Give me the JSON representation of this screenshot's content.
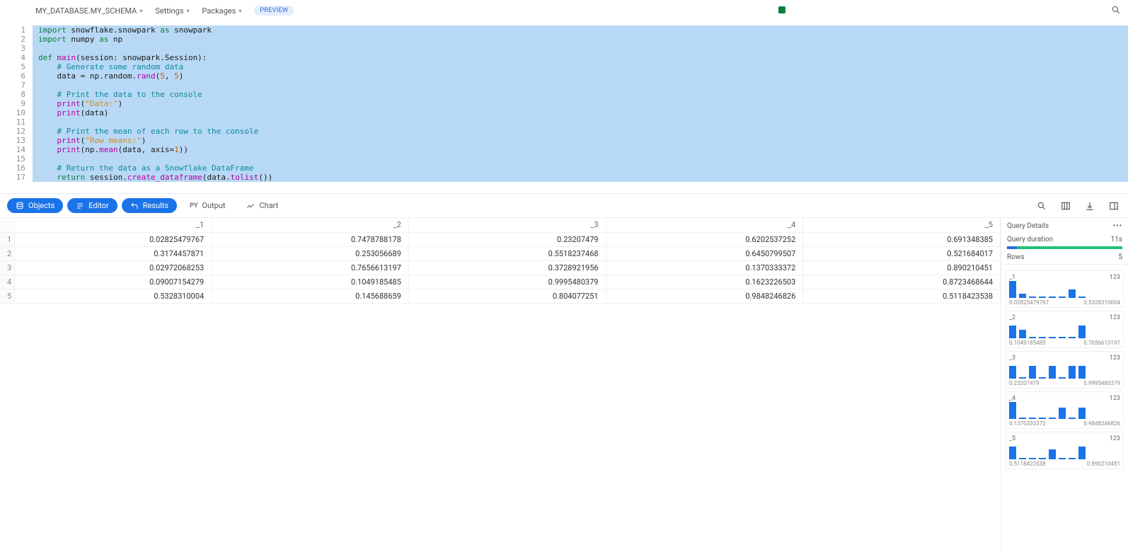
{
  "toolbar": {
    "context": "MY_DATABASE.MY_SCHEMA",
    "settings": "Settings",
    "packages": "Packages",
    "preview": "PREVIEW"
  },
  "editor": {
    "lines": [
      [
        [
          "kw",
          "import"
        ],
        [
          "id",
          " snowflake.snowpark "
        ],
        [
          "kw",
          "as"
        ],
        [
          "id",
          " snowpark"
        ]
      ],
      [
        [
          "kw",
          "import"
        ],
        [
          "id",
          " numpy "
        ],
        [
          "kw",
          "as"
        ],
        [
          "id",
          " np"
        ]
      ],
      [
        [
          "id",
          ""
        ]
      ],
      [
        [
          "kw",
          "def "
        ],
        [
          "fn",
          "main"
        ],
        [
          "id",
          "(session: snowpark.Session):"
        ]
      ],
      [
        [
          "id",
          "    "
        ],
        [
          "cm",
          "# Generate some random data"
        ]
      ],
      [
        [
          "id",
          "    data = np.random."
        ],
        [
          "fn",
          "rand"
        ],
        [
          "id",
          "("
        ],
        [
          "num",
          "5"
        ],
        [
          "id",
          ", "
        ],
        [
          "num",
          "5"
        ],
        [
          "id",
          ")"
        ]
      ],
      [
        [
          "id",
          ""
        ]
      ],
      [
        [
          "id",
          "    "
        ],
        [
          "cm",
          "# Print the data to the console"
        ]
      ],
      [
        [
          "id",
          "    "
        ],
        [
          "fn",
          "print"
        ],
        [
          "id",
          "("
        ],
        [
          "str",
          "\"Data:\""
        ],
        [
          "id",
          ")"
        ]
      ],
      [
        [
          "id",
          "    "
        ],
        [
          "fn",
          "print"
        ],
        [
          "id",
          "(data)"
        ]
      ],
      [
        [
          "id",
          ""
        ]
      ],
      [
        [
          "id",
          "    "
        ],
        [
          "cm",
          "# Print the mean of each row to the console"
        ]
      ],
      [
        [
          "id",
          "    "
        ],
        [
          "fn",
          "print"
        ],
        [
          "id",
          "("
        ],
        [
          "str",
          "\"Row means:\""
        ],
        [
          "id",
          ")"
        ]
      ],
      [
        [
          "id",
          "    "
        ],
        [
          "fn",
          "print"
        ],
        [
          "id",
          "(np."
        ],
        [
          "fn",
          "mean"
        ],
        [
          "id",
          "(data, axis="
        ],
        [
          "num",
          "1"
        ],
        [
          "id",
          "))"
        ]
      ],
      [
        [
          "id",
          ""
        ]
      ],
      [
        [
          "id",
          "    "
        ],
        [
          "cm",
          "# Return the data as a Snowflake DataFrame"
        ]
      ],
      [
        [
          "id",
          "    "
        ],
        [
          "kw",
          "return"
        ],
        [
          "id",
          " session."
        ],
        [
          "fn",
          "create_dataframe"
        ],
        [
          "id",
          "(data."
        ],
        [
          "fn",
          "tolist"
        ],
        [
          "id",
          "())"
        ]
      ]
    ]
  },
  "result_tabs": {
    "objects": "Objects",
    "editor": "Editor",
    "results": "Results",
    "output": "Output",
    "output_prefix": "PY",
    "chart": "Chart"
  },
  "table": {
    "headers": [
      "_1",
      "_2",
      "_3",
      "_4",
      "_5"
    ],
    "rows": [
      [
        "0.02825479767",
        "0.7478788178",
        "0.23207479",
        "0.6202537252",
        "0.691348385"
      ],
      [
        "0.3174457871",
        "0.253056689",
        "0.5518237468",
        "0.6450799507",
        "0.521684017"
      ],
      [
        "0.02972068253",
        "0.7656613197",
        "0.3728921956",
        "0.1370333372",
        "0.890210451"
      ],
      [
        "0.09007154279",
        "0.1049185485",
        "0.9995480379",
        "0.1623226503",
        "0.8723468644"
      ],
      [
        "0.5328310004",
        "0.145688659",
        "0.804077251",
        "0.9848246826",
        "0.5118423538"
      ]
    ]
  },
  "details": {
    "title": "Query Details",
    "duration_label": "Query duration",
    "duration_value": "11s",
    "rows_label": "Rows",
    "rows_value": "5",
    "type_label": "123",
    "hist": [
      {
        "name": "_1",
        "min": "0.02825479767",
        "max": "0.5328310004",
        "bars": [
          24,
          6,
          2,
          2,
          2,
          2,
          12,
          2
        ]
      },
      {
        "name": "_2",
        "min": "0.1049185485",
        "max": "0.7656613197",
        "bars": [
          18,
          12,
          2,
          2,
          2,
          2,
          2,
          18
        ]
      },
      {
        "name": "_3",
        "min": "0.23207479",
        "max": "0.9995480379",
        "bars": [
          18,
          2,
          18,
          2,
          18,
          2,
          18,
          18
        ]
      },
      {
        "name": "_4",
        "min": "0.1370333372",
        "max": "0.9848246826",
        "bars": [
          24,
          2,
          2,
          2,
          2,
          16,
          2,
          16
        ]
      },
      {
        "name": "_5",
        "min": "0.5118423538",
        "max": "0.890210451",
        "bars": [
          18,
          2,
          2,
          2,
          14,
          2,
          2,
          18
        ]
      }
    ]
  },
  "chart_data": {
    "type": "table",
    "columns": [
      "_1",
      "_2",
      "_3",
      "_4",
      "_5"
    ],
    "rows": [
      [
        0.02825479767,
        0.7478788178,
        0.23207479,
        0.6202537252,
        0.691348385
      ],
      [
        0.3174457871,
        0.253056689,
        0.5518237468,
        0.6450799507,
        0.521684017
      ],
      [
        0.02972068253,
        0.7656613197,
        0.3728921956,
        0.1370333372,
        0.890210451
      ],
      [
        0.09007154279,
        0.1049185485,
        0.9995480379,
        0.1623226503,
        0.8723468644
      ],
      [
        0.5328310004,
        0.145688659,
        0.804077251,
        0.9848246826,
        0.5118423538
      ]
    ],
    "histograms": [
      {
        "name": "_1",
        "min": 0.02825479767,
        "max": 0.5328310004
      },
      {
        "name": "_2",
        "min": 0.1049185485,
        "max": 0.7656613197
      },
      {
        "name": "_3",
        "min": 0.23207479,
        "max": 0.9995480379
      },
      {
        "name": "_4",
        "min": 0.1370333372,
        "max": 0.9848246826
      },
      {
        "name": "_5",
        "min": 0.5118423538,
        "max": 0.890210451
      }
    ]
  }
}
